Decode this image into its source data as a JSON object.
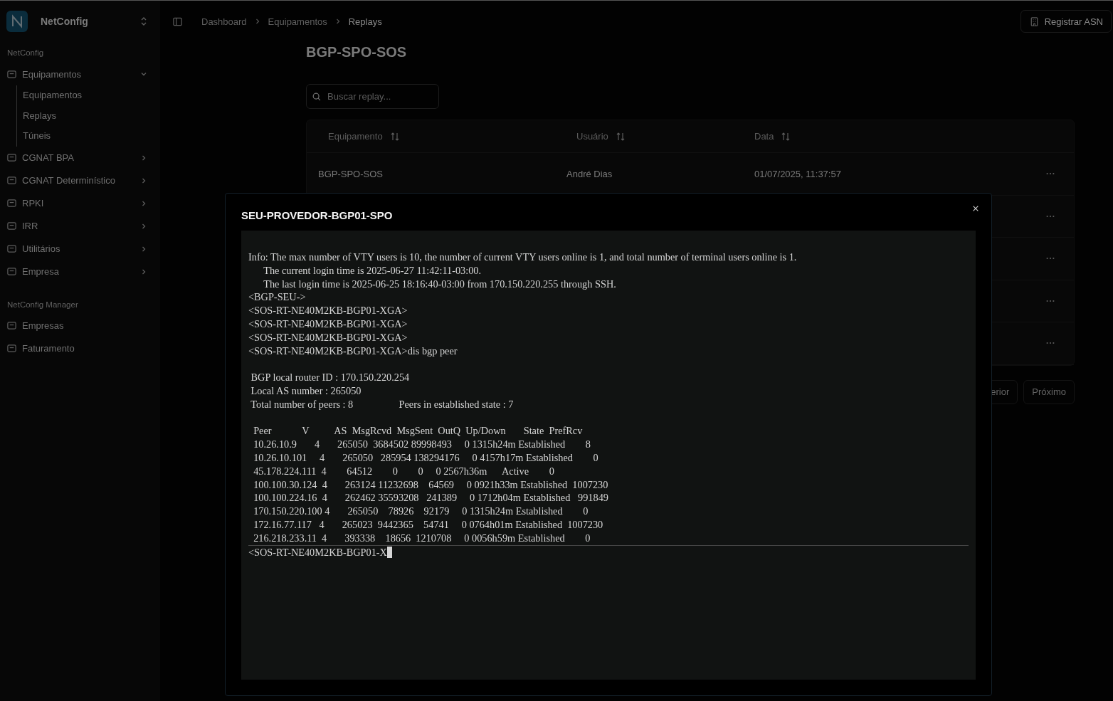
{
  "sidebar": {
    "app_name": "NetConfig",
    "sections": [
      {
        "heading": "NetConfig",
        "items": [
          {
            "label": "Equipamentos",
            "expanded": true,
            "children": [
              {
                "label": "Equipamentos"
              },
              {
                "label": "Replays"
              },
              {
                "label": "Túneis"
              }
            ]
          },
          {
            "label": "CGNAT BPA",
            "expanded": false
          },
          {
            "label": "CGNAT Determinístico",
            "expanded": false
          },
          {
            "label": "RPKI",
            "expanded": false
          },
          {
            "label": "IRR",
            "expanded": false
          },
          {
            "label": "Utilitários",
            "expanded": false
          },
          {
            "label": "Empresa",
            "expanded": false
          }
        ]
      },
      {
        "heading": "NetConfig Manager",
        "items": [
          {
            "label": "Empresas"
          },
          {
            "label": "Faturamento"
          }
        ]
      }
    ]
  },
  "breadcrumb": [
    "Dashboard",
    "Equipamentos",
    "Replays"
  ],
  "header_button": "Registrar ASN",
  "page_title": "BGP-SPO-SOS",
  "search": {
    "placeholder": "Buscar replay..."
  },
  "table": {
    "columns": [
      "Equipamento",
      "Usuário",
      "Data"
    ],
    "rows": [
      {
        "kind": "full",
        "cells": [
          "BGP-SPO-SOS",
          "André Dias",
          "01/07/2025, 11:37:57"
        ]
      },
      {
        "kind": "covered"
      },
      {
        "kind": "covered"
      },
      {
        "kind": "covered"
      },
      {
        "kind": "covered"
      }
    ]
  },
  "pagination": [
    "erior",
    "Próximo"
  ],
  "modal": {
    "title": "SEU-PROVEDOR-BGP01-SPO",
    "terminal": {
      "blocks": [
        [
          "Info: The max number of VTY users is 10, the number of current VTY users online is 1, and total number of terminal users online is 1.",
          "      The current login time is 2025-06-27 11:42:11-03:00.",
          "      The last login time is 2025-06-25 18:16:40-03:00 from 170.150.220.255 through SSH.",
          "<BGP-SEU->",
          "<SOS-RT-NE40M2KB-BGP01-XGA>",
          "<SOS-RT-NE40M2KB-BGP01-XGA>",
          "<SOS-RT-NE40M2KB-BGP01-XGA>",
          "<SOS-RT-NE40M2KB-BGP01-XGA>dis bgp peer"
        ],
        [
          " BGP local router ID : 170.150.220.254",
          " Local AS number : 265050",
          " Total number of peers : 8                  Peers in established state : 7"
        ],
        [
          "  Peer            V          AS  MsgRcvd  MsgSent  OutQ  Up/Down       State  PrefRcv",
          "  10.26.10.9       4       265050  3684502 89998493     0 1315h24m Established        8",
          "  10.26.10.101     4       265050   285954 138294176     0 4157h17m Established        0",
          "  45.178.224.111  4        64512        0        0     0 2567h36m      Active        0",
          "  100.100.30.124  4       263124 11232698    64569     0 0921h33m Established  1007230",
          "  100.100.224.16  4       262462 35593208   241389     0 1712h04m Established   991849",
          "  170.150.220.100 4       265050    78926    92179     0 1315h24m Established        0",
          "  172.16.77.117   4       265023  9442365    54741     0 0764h01m Established  1007230",
          "  216.218.233.11  4       393338    18656  1210708     0 0056h59m Established        0"
        ]
      ],
      "prompt": "<SOS-RT-NE40M2KB-BGP01-X"
    }
  }
}
